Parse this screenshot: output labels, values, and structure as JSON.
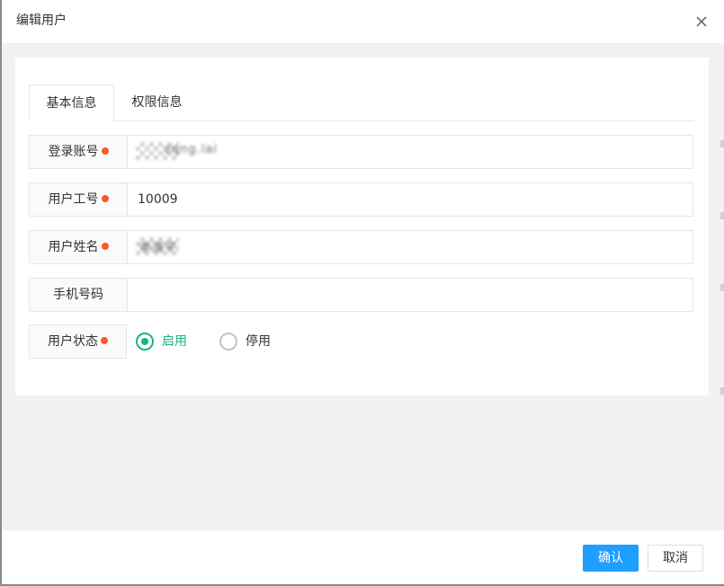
{
  "dialog": {
    "title": "编辑用户",
    "close_icon": "close-icon"
  },
  "tabs": [
    {
      "label": "基本信息",
      "active": true
    },
    {
      "label": "权限信息",
      "active": false
    }
  ],
  "form": {
    "login_account": {
      "label": "登录账号",
      "value": "zqng.lai",
      "required": true
    },
    "employee_id": {
      "label": "用户工号",
      "value": "10009",
      "required": true
    },
    "user_name": {
      "label": "用户姓名",
      "value": "李清平",
      "required": true
    },
    "phone": {
      "label": "手机号码",
      "value": "",
      "required": false
    },
    "status": {
      "label": "用户状态",
      "required": true,
      "options": [
        {
          "label": "启用",
          "selected": true
        },
        {
          "label": "停用",
          "selected": false
        }
      ]
    }
  },
  "footer": {
    "confirm_label": "确认",
    "cancel_label": "取消"
  },
  "colors": {
    "primary": "#1e9fff",
    "success": "#16b777",
    "required": "#ff5722",
    "body_bg": "#f1f1f1"
  }
}
